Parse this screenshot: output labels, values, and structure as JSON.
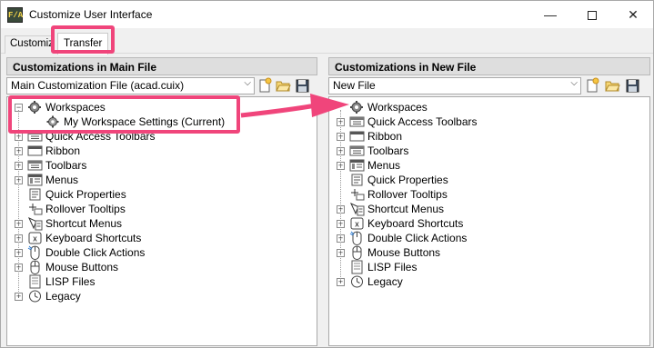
{
  "window": {
    "title": "Customize User Interface",
    "app_icon_text": "F/A",
    "controls": {
      "minimize": "—",
      "close": "✕"
    }
  },
  "tabs": [
    {
      "label": "Customize"
    },
    {
      "label": "Transfer"
    }
  ],
  "left_panel": {
    "header": "Customizations in Main File",
    "file_combo": "Main Customization File (acad.cuix)",
    "tree": [
      {
        "label": "Workspaces",
        "icon": "workspaces-icon",
        "expander": "−"
      },
      {
        "label": "My Workspace Settings (Current)",
        "icon": "workspace-gear-icon"
      },
      {
        "label": "Quick Access Toolbars",
        "icon": "toolbar-icon",
        "expander": "+"
      },
      {
        "label": "Ribbon",
        "icon": "ribbon-icon",
        "expander": "+"
      },
      {
        "label": "Toolbars",
        "icon": "toolbar-icon",
        "expander": "+"
      },
      {
        "label": "Menus",
        "icon": "menu-icon",
        "expander": "+"
      },
      {
        "label": "Quick Properties",
        "icon": "quick-properties-icon"
      },
      {
        "label": "Rollover Tooltips",
        "icon": "rollover-tooltips-icon"
      },
      {
        "label": "Shortcut Menus",
        "icon": "shortcut-menu-icon",
        "expander": "+"
      },
      {
        "label": "Keyboard Shortcuts",
        "icon": "keyboard-icon",
        "expander": "+"
      },
      {
        "label": "Double Click Actions",
        "icon": "double-click-icon",
        "expander": "+"
      },
      {
        "label": "Mouse Buttons",
        "icon": "mouse-icon",
        "expander": "+"
      },
      {
        "label": "LISP Files",
        "icon": "lisp-file-icon"
      },
      {
        "label": "Legacy",
        "icon": "legacy-clock-icon",
        "expander": "+"
      }
    ]
  },
  "right_panel": {
    "header": "Customizations in New File",
    "file_combo": "New File",
    "tree": [
      {
        "label": "Workspaces",
        "icon": "workspaces-icon"
      },
      {
        "label": "Quick Access Toolbars",
        "icon": "toolbar-icon",
        "expander": "+"
      },
      {
        "label": "Ribbon",
        "icon": "ribbon-icon",
        "expander": "+"
      },
      {
        "label": "Toolbars",
        "icon": "toolbar-icon",
        "expander": "+"
      },
      {
        "label": "Menus",
        "icon": "menu-icon",
        "expander": "+"
      },
      {
        "label": "Quick Properties",
        "icon": "quick-properties-icon"
      },
      {
        "label": "Rollover Tooltips",
        "icon": "rollover-tooltips-icon"
      },
      {
        "label": "Shortcut Menus",
        "icon": "shortcut-menu-icon",
        "expander": "+"
      },
      {
        "label": "Keyboard Shortcuts",
        "icon": "keyboard-icon",
        "expander": "+"
      },
      {
        "label": "Double Click Actions",
        "icon": "double-click-icon",
        "expander": "+"
      },
      {
        "label": "Mouse Buttons",
        "icon": "mouse-icon",
        "expander": "+"
      },
      {
        "label": "LISP Files",
        "icon": "lisp-file-icon"
      },
      {
        "label": "Legacy",
        "icon": "legacy-clock-icon",
        "expander": "+"
      }
    ]
  },
  "colors": {
    "annotation_pink": "#f0457b",
    "window_bg": "#f0f0f0",
    "header_bg": "#dedede"
  }
}
